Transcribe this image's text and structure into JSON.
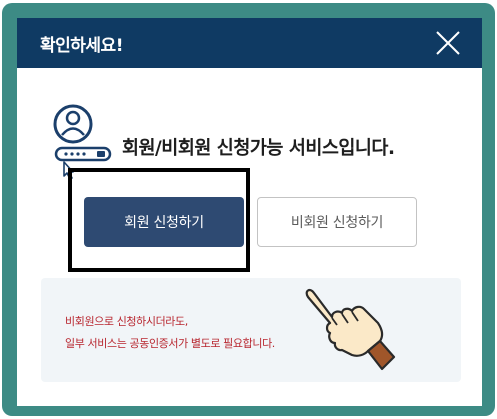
{
  "dialog": {
    "title": "확인하세요!",
    "headline": "회원/비회원 신청가능 서비스입니다.",
    "buttons": {
      "member_label": "회원 신청하기",
      "guest_label": "비회원 신청하기"
    },
    "notice": {
      "line1": "비회원으로 신청하시더라도,",
      "line2": "일부 서비스는 공동인증서가 별도로 필요합니다."
    }
  },
  "icons": {
    "close": "close-icon",
    "user_login": "user-password-icon",
    "pointer": "hand-pointer-icon"
  },
  "colors": {
    "frame": "#3d8b85",
    "header": "#0f3a63",
    "member_button": "#2e4a72",
    "notice_text": "#b8262f",
    "notice_background": "#f1f5f8",
    "icon_accent": "#1b3f6b"
  }
}
